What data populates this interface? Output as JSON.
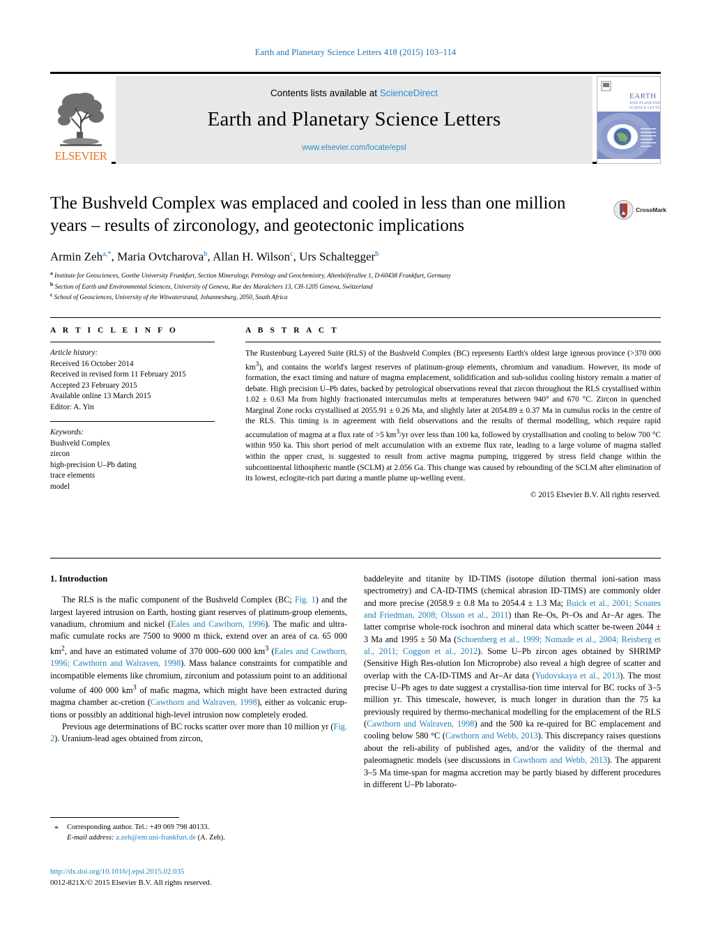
{
  "running_head": "Earth and Planetary Science Letters 418 (2015) 103–114",
  "masthead": {
    "contents_prefix": "Contents lists available at ",
    "sciencedirect": "ScienceDirect",
    "journal_title": "Earth and Planetary Science Letters",
    "journal_url": "www.elsevier.com/locate/epsl",
    "publisher_wordmark": "ELSEVIER",
    "cover_title_line1": "EARTH",
    "cover_title_line2": "AND PLANETARY",
    "cover_title_line3": "SCIENCE LETTERS"
  },
  "article": {
    "title": "The Bushveld Complex was emplaced and cooled in less than one million years – results of zirconology, and geotectonic implications",
    "crossmark_label": "CrossMark",
    "authors_html": "Armin Zeh<sup>a,*</sup>, Maria Ovtcharova<sup>b</sup>, Allan H. Wilson<sup>c</sup>, Urs Schaltegger<sup>b</sup>",
    "affiliations": [
      {
        "mark": "a",
        "text": "Institute for Geosciences, Goethe University Frankfurt, Section Mineralogy, Petrology and Geochemistry, Altenhöferallee 1, D-60438 Frankfurt, Germany"
      },
      {
        "mark": "b",
        "text": "Section of Earth and Environmental Sciences, University of Geneva, Rue des Maraîchers 13, CH-1205 Geneva, Switzerland"
      },
      {
        "mark": "c",
        "text": "School of Geosciences, University of the Witwatersrand, Johannesburg, 2050, South Africa"
      }
    ]
  },
  "article_info": {
    "heading": "A R T I C L E   I N F O",
    "history_label": "Article history:",
    "history": [
      "Received 16 October 2014",
      "Received in revised form 11 February 2015",
      "Accepted 23 February 2015",
      "Available online 13 March 2015",
      "Editor: A. Yin"
    ],
    "keywords_label": "Keywords:",
    "keywords": [
      "Bushveld Complex",
      "zircon",
      "high-precision U–Pb dating",
      "trace elements",
      "model"
    ]
  },
  "abstract": {
    "heading": "A B S T R A C T",
    "body_html": "The Rustenburg Layered Suite (RLS) of the Bushveld Complex (BC) represents Earth's oldest large igneous province (&gt;370 000 km<sup>3</sup>), and contains the world's largest reserves of platinum-group elements, chromium and vanadium. However, its mode of formation, the exact timing and nature of magma emplacement, solidification and sub-solidus cooling history remain a matter of debate. High precision U–Pb dates, backed by petrological observations reveal that zircon throughout the RLS crystallised within 1.02 ± 0.63 Ma from highly fractionated intercumulus melts at temperatures between 940° and 670 °C. Zircon in quenched Marginal Zone rocks crystallised at 2055.91 ± 0.26 Ma, and slightly later at 2054.89 ± 0.37 Ma in cumulus rocks in the centre of the RLS. This timing is in agreement with field observations and the results of thermal modelling, which require rapid accumulation of magma at a flux rate of &gt;5 km<sup>3</sup>/yr over less than 100 ka, followed by crystallisation and cooling to below 700 °C within 950 ka. This short period of melt accumulation with an extreme flux rate, leading to a large volume of magma stalled within the upper crust, is suggested to result from active magma pumping, triggered by stress field change within the subcontinental lithospheric mantle (SCLM) at 2.056 Ga. This change was caused by rebounding of the SCLM after elimination of its lowest, eclogite-rich part during a mantle plume up-welling event.",
    "copyright": "© 2015 Elsevier B.V. All rights reserved."
  },
  "body": {
    "section_heading": "1. Introduction",
    "left_paragraphs_html": [
      "The RLS is the mafic component of the Bushveld Complex (BC; <span class=\"ref\">Fig. 1</span>) and the largest layered intrusion on Earth, hosting giant reserves of platinum-group elements, vanadium, chromium and nickel (<span class=\"ref\">Eales and Cawthorn, 1996</span>). The mafic and ultra-mafic cumulate rocks are 7500 to 9000 m thick, extend over an area of ca. 65 000 km<sup>2</sup>, and have an estimated volume of 370 000–600 000 km<sup>3</sup> (<span class=\"ref\">Eales and Cawthorn, 1996; Cawthorn and Walraven, 1998</span>). Mass balance constraints for compatible and incompatible elements like chromium, zirconium and potassium point to an additional volume of 400 000 km<sup>3</sup> of mafic magma, which might have been extracted during magma chamber ac-cretion (<span class=\"ref\">Cawthorn and Walraven, 1998</span>), either as volcanic erup-tions or possibly an additional high-level intrusion now completely eroded.",
      "Previous age determinations of BC rocks scatter over more than 10 million yr (<span class=\"ref\">Fig. 2</span>). Uranium-lead ages obtained from zircon,"
    ],
    "right_paragraphs_html": [
      "baddeleyite and titanite by ID-TIMS (isotope dilution thermal ioni-sation mass spectrometry) and CA-ID-TIMS (chemical abrasion ID-TIMS) are commonly older and more precise (2058.9 ± 0.8 Ma to 2054.4 ± 1.3 Ma; <span class=\"ref\">Buick et al., 2001; Scoates and Friedman, 2008; Olsson et al., 2011</span>) than Re–Os, Pt–Os and Ar–Ar ages. The latter comprise whole-rock isochron and mineral data which scatter be-tween 2044 ± 3 Ma and 1995 ± 50 Ma (<span class=\"ref\">Schoenberg et al., 1999; Nomade et al., 2004; Reisberg et al., 2011; Coggon et al., 2012</span>). Some U–Pb zircon ages obtained by SHRIMP (Sensitive High Res-olution Ion Microprobe) also reveal a high degree of scatter and overlap with the CA-ID-TIMS and Ar–Ar data (<span class=\"ref\">Yudovskaya et al., 2013</span>). The most precise U–Pb ages to date suggest a crystallisa-tion time interval for BC rocks of 3–5 million yr. This timescale, however, is much longer in duration than the 75 ka previously required by thermo-mechanical modelling for the emplacement of the RLS (<span class=\"ref\">Cawthorn and Walraven, 1998</span>) and the 500 ka re-quired for BC emplacement and cooling below 580 °C (<span class=\"ref\">Cawthorn and Webb, 2013</span>). This discrepancy raises questions about the reli-ability of published ages, and/or the validity of the thermal and paleomagnetic models (see discussions in <span class=\"ref\">Cawthorn and Webb, 2013</span>). The apparent 3–5 Ma time-span for magma accretion may be partly biased by different procedures in different U–Pb laborato-"
    ]
  },
  "footnotes": {
    "star": "*",
    "corresponding": "Corresponding author. Tel.: +49 069 798 40133.",
    "email_label": "E-mail address:",
    "email": "a.zeh@em.uni-frankfurt.de",
    "email_suffix": "(A. Zeh)."
  },
  "imprint": {
    "doi": "http://dx.doi.org/10.1016/j.epsl.2015.02.035",
    "issn_line": "0012-821X/© 2015 Elsevier B.V. All rights reserved."
  },
  "colors": {
    "link_blue": "#1f7fb8",
    "header_blue": "#1f6fb0",
    "elsevier_orange": "#E9711C",
    "band_gray": "#e8e8e8"
  }
}
